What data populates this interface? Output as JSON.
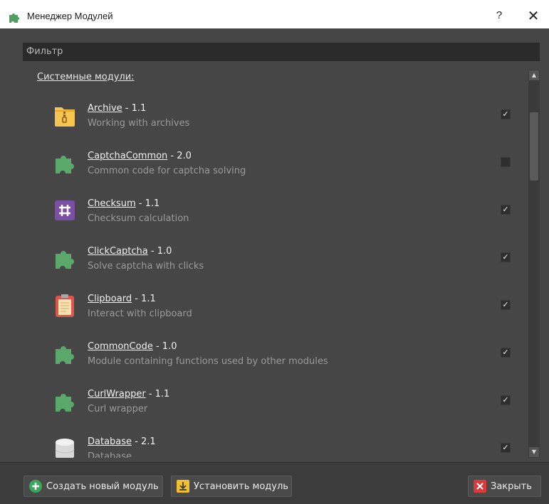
{
  "window": {
    "title": "Менеджер Модулей",
    "help_glyph": "?",
    "close_glyph": "✕"
  },
  "filter": {
    "placeholder": "Фильтр",
    "value": ""
  },
  "section": {
    "title": "Системные модули:"
  },
  "modules": [
    {
      "name": "Archive",
      "version": " - 1.1",
      "description": "Working with archives",
      "icon": "archive-zip-icon",
      "checked": true
    },
    {
      "name": "CaptchaCommon",
      "version": " - 2.0",
      "description": "Common code for captcha solving",
      "icon": "puzzle-icon",
      "checked": false
    },
    {
      "name": "Checksum",
      "version": " - 1.1",
      "description": "Checksum calculation",
      "icon": "hash-icon",
      "checked": true
    },
    {
      "name": "ClickCaptcha",
      "version": " - 1.0",
      "description": "Solve captcha with clicks",
      "icon": "puzzle-icon",
      "checked": true
    },
    {
      "name": "Clipboard",
      "version": " - 1.1",
      "description": "Interact with clipboard",
      "icon": "clipboard-icon",
      "checked": true
    },
    {
      "name": "CommonCode",
      "version": " - 1.0",
      "description": "Module containing functions used by other modules",
      "icon": "puzzle-icon",
      "checked": true
    },
    {
      "name": "CurlWrapper",
      "version": " - 1.1",
      "description": "Curl wrapper",
      "icon": "puzzle-icon",
      "checked": true
    },
    {
      "name": "Database",
      "version": " - 2.1",
      "description": "Database",
      "icon": "database-icon",
      "checked": true
    }
  ],
  "check_glyph": "✓",
  "buttons": {
    "create": "Создать новый модуль",
    "install": "Установить модуль",
    "close": "Закрыть"
  },
  "colors": {
    "client_bg": "#464646",
    "puzzle_green": "#5aa86a",
    "hash_purple": "#7b4fa6",
    "clipboard_red": "#e0554a",
    "archive_yellow": "#f5c451",
    "create_green": "#3aa85a",
    "install_yellow": "#f2c02f",
    "close_red": "#d93a3a"
  }
}
